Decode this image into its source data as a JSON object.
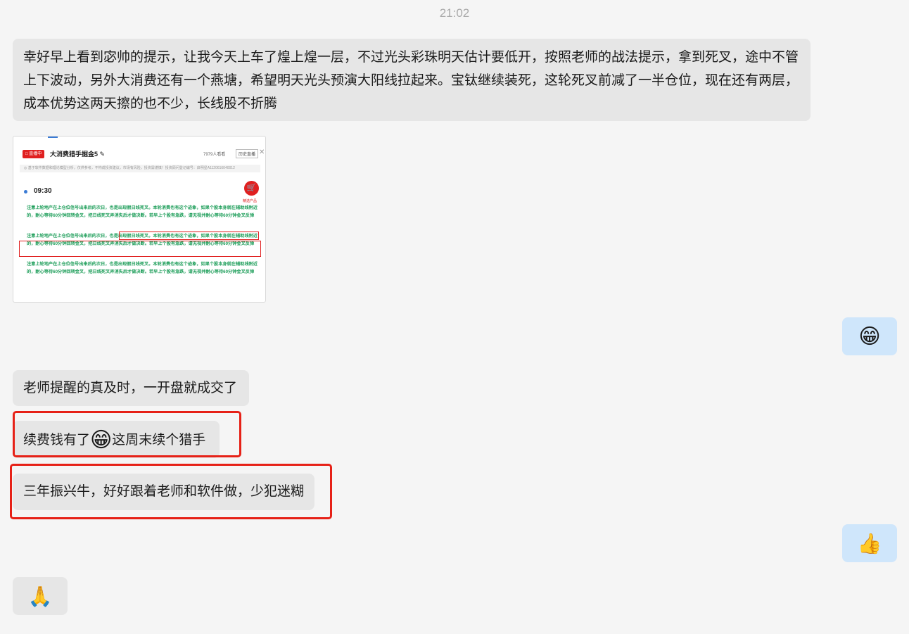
{
  "header": {
    "time": "21:02"
  },
  "messages": {
    "m1": {
      "line1": "幸好早上看到宓帅的提示，让我今天上车了煌上煌一层，不过光头彩珠明天估计要低开，按照老师的战法提示，拿到死叉，途中不管",
      "line2": "上下波动，另外大消费还有一个燕塘，希望明天光头预演大阳线拉起来。宝钛继续装死，这轮死叉前减了一半仓位，现在还有两层，",
      "line3": "成本优势这两天擦的也不少，长线股不折腾"
    },
    "m3": {
      "emoji": "😁"
    },
    "m4": {
      "text": "老师提醒的真及时，一开盘就成交了"
    },
    "m5": {
      "before": "续费钱有了",
      "emoji": "😁",
      "after": "这周末续个猎手"
    },
    "m6": {
      "text": "三年振兴牛，好好跟着老师和软件做，少犯迷糊"
    },
    "m7": {
      "emoji": "👍"
    },
    "m8": {
      "emoji": "🙏"
    }
  },
  "shot": {
    "live_badge": "□ 直播中",
    "title": "大消费猎手掘金5 ✎",
    "viewers": "7979人看看",
    "history": "历史直播",
    "close": "✕",
    "notice": "◎ 基于软件数据和理论模型分析，仅供参考，不构成投资建议，市场有风险，投资需谨慎！投资顾问登记编号：启明星A1120616040012",
    "time": "09:30",
    "cart_icon": "🛒",
    "cart_label": "精选产品",
    "paragraph": "注意上轮地产在上仓位信号出来后的次日，也是出现假日线死叉。本轮消费也有这个迹象，如果个股本身就在辅助线附近的，耐心等待60分钟回转金叉，把日线死叉弄消失后才做决断。若早上个股有急跌，请无视并耐心等待60分钟金叉反弹"
  }
}
